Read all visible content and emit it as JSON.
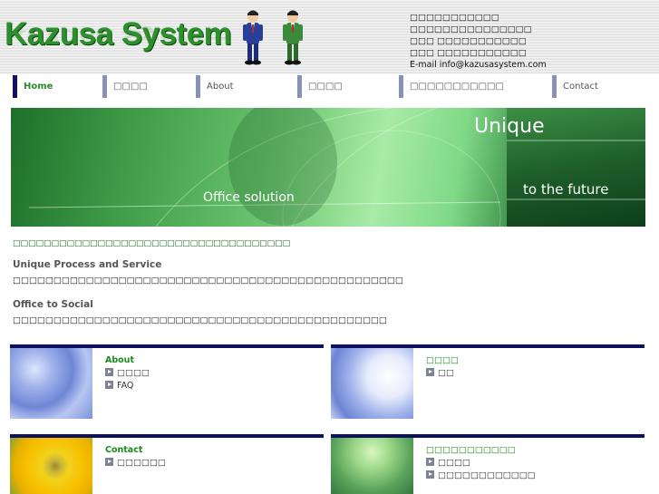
{
  "header": {
    "logo": "Kazusa System",
    "contact_lines": [
      "□□□□□□□□□□□",
      "□□□□□□□□□□□□□□□",
      "□□□ □□□□□□□□□□□",
      "□□□ □□□□□□□□□□□",
      "E-mail info@kazusasystem.com"
    ]
  },
  "nav": {
    "items": [
      {
        "label": "Home"
      },
      {
        "label": "□□□□"
      },
      {
        "label": "About"
      },
      {
        "label": "□□□□"
      },
      {
        "label": "□□□□□□□□□□□"
      },
      {
        "label": "Contact"
      }
    ]
  },
  "banner": {
    "unique": "Unique",
    "future": "to the future",
    "office": "Office solution"
  },
  "intro": {
    "lead": "□□□□□□□□□□□□□□□□□□□□□□□□□□□□□□□□□□□□",
    "heading1": "Unique Process and Service",
    "text1": "□□□□□□□□□□□□□□□□□□□□□□□□□□□□□□□□□□□□□□□□□□□□□□□□",
    "heading2": "Office to Social",
    "text2": "□□□□□□□□□□□□□□□□□□□□□□□□□□□□□□□□□□□□□□□□□□□□□□"
  },
  "cards": [
    {
      "title": "About",
      "links": [
        "□□□□",
        "FAQ"
      ]
    },
    {
      "title": "□□□□",
      "links": [
        "□□"
      ]
    },
    {
      "title": "Contact",
      "links": [
        "□□□□□□"
      ]
    },
    {
      "title": "□□□□□□□□□□□",
      "links": [
        "□□□□",
        "□□□□□□□□□□□□"
      ]
    }
  ],
  "colors": {
    "brand_green": "#2e8f2e",
    "nav_dark": "#10106b",
    "card_bar": "#0d1260",
    "link_green": "#1a8a1a"
  }
}
